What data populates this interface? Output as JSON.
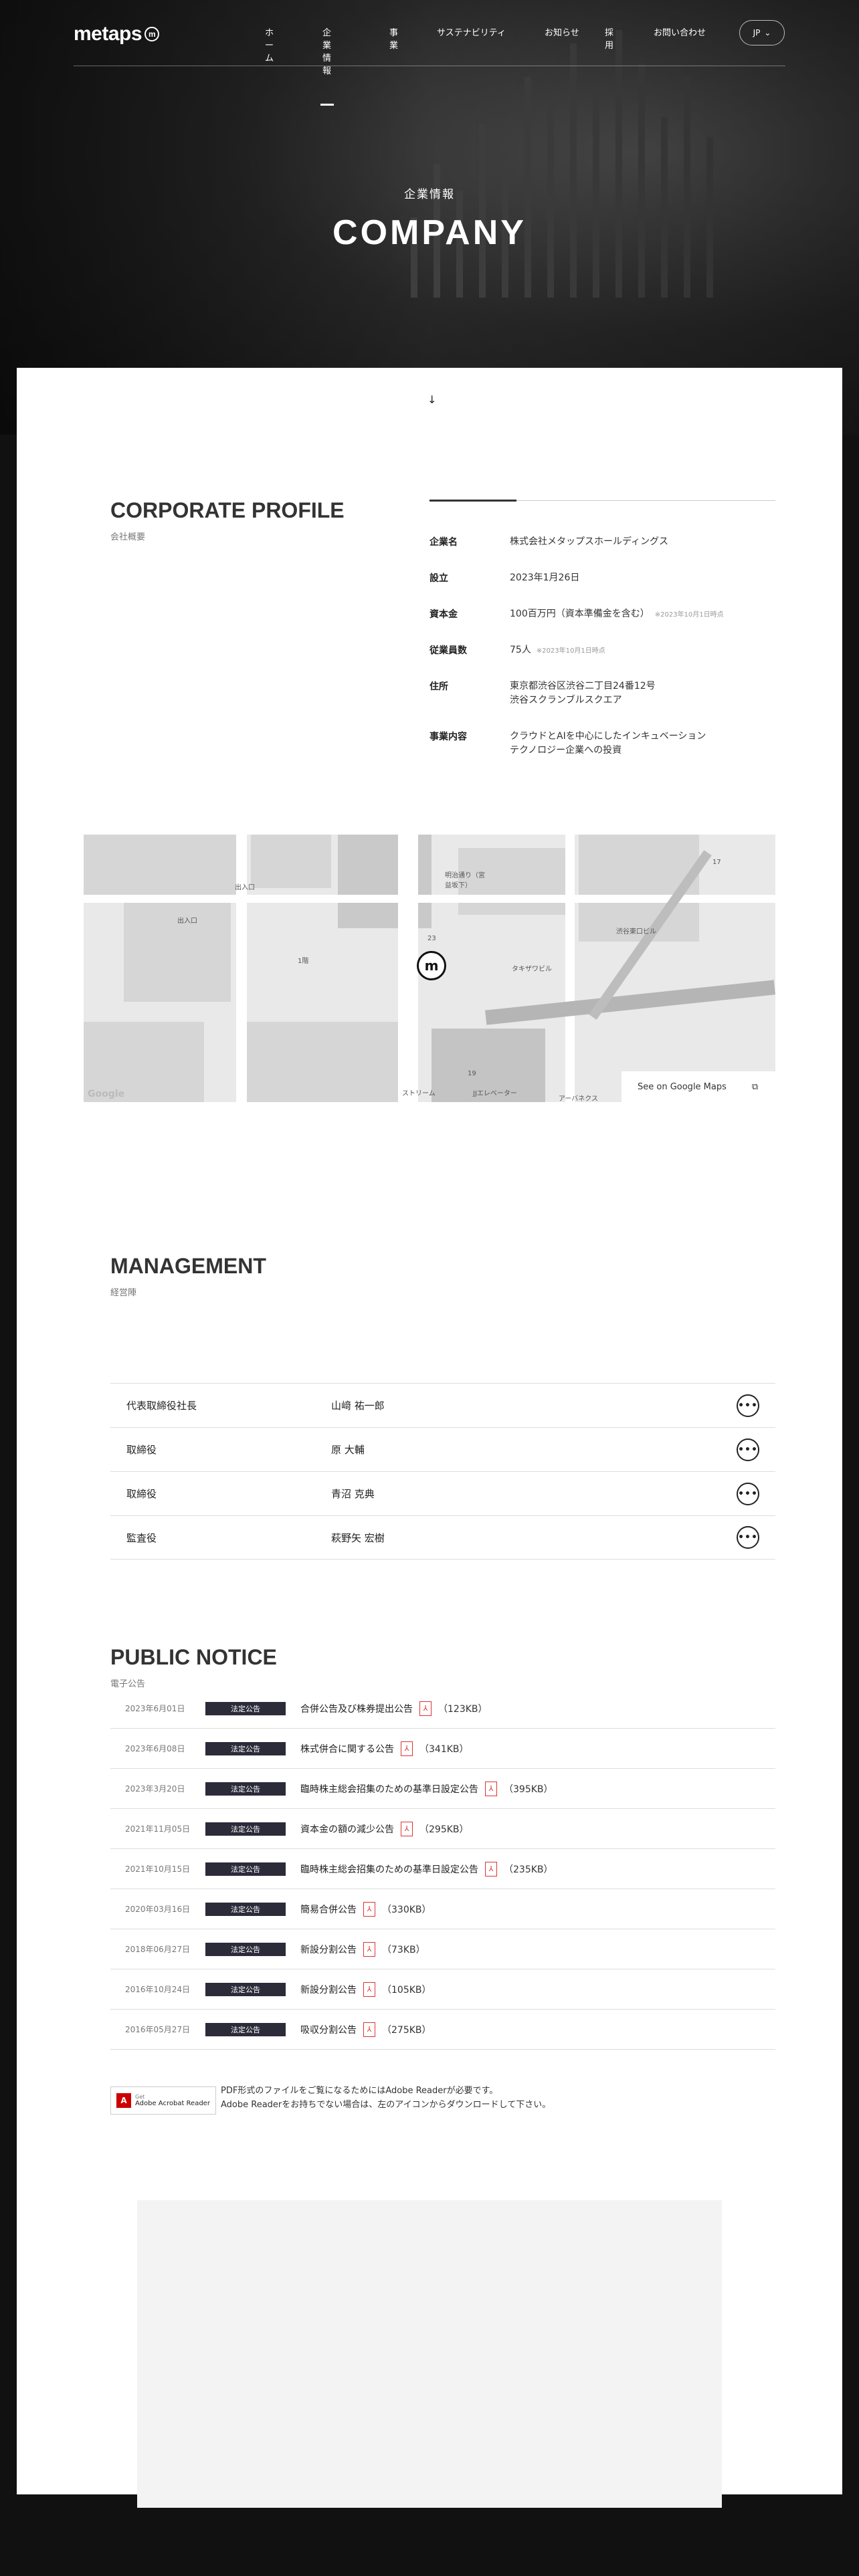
{
  "header": {
    "logo": "metaps",
    "logo_badge": "m",
    "nav": [
      "ホーム",
      "企業情報",
      "事業",
      "サステナビリティ",
      "お知らせ",
      "採用",
      "お問い合わせ"
    ],
    "active_nav": "企業情報",
    "lang": "JP"
  },
  "hero": {
    "subtitle": "企業情報",
    "title": "COMPANY"
  },
  "profile": {
    "title": "CORPORATE PROFILE",
    "subtitle": "会社概要",
    "rows": [
      {
        "label": "企業名",
        "value": "株式会社メタップスホールディングス",
        "note": ""
      },
      {
        "label": "設立",
        "value": "2023年1月26日",
        "note": ""
      },
      {
        "label": "資本金",
        "value": "100百万円（資本準備金を含む）",
        "note": "※2023年10月1日時点"
      },
      {
        "label": "従業員数",
        "value": "75人",
        "note": "※2023年10月1日時点"
      },
      {
        "label": "住所",
        "value": "東京都渋谷区渋谷二丁目24番12号",
        "value2": "渋谷スクランブルスクエア",
        "note": ""
      },
      {
        "label": "事業内容",
        "value": "クラウドとAIを中心にしたインキュベーション",
        "value2": "テクノロジー企業への投資",
        "note": ""
      }
    ]
  },
  "map": {
    "link": "See on Google Maps",
    "google": "Google",
    "labels": [
      "出入口",
      "出入口",
      "1階",
      "明治通り（宮益坂下）",
      "23",
      "19",
      "17",
      "渋谷東口ビル",
      "タキザワビル",
      "ストリーム",
      "JJエレベーター",
      "アーバネクス"
    ]
  },
  "management": {
    "title": "MANAGEMENT",
    "subtitle": "経営陣",
    "members": [
      {
        "role": "代表取締役社長",
        "name": "山﨑 祐一郎"
      },
      {
        "role": "取締役",
        "name": "原 大輔"
      },
      {
        "role": "取締役",
        "name": "青沼 克典"
      },
      {
        "role": "監査役",
        "name": "萩野矢 宏樹"
      }
    ]
  },
  "notice": {
    "title": "PUBLIC NOTICE",
    "subtitle": "電子公告",
    "badge": "法定公告",
    "items": [
      {
        "date": "2023年6月01日",
        "title": "合併公告及び株券提出公告",
        "size": "（123KB）"
      },
      {
        "date": "2023年6月08日",
        "title": "株式併合に関する公告",
        "size": "（341KB）"
      },
      {
        "date": "2023年3月20日",
        "title": "臨時株主総会招集のための基準日設定公告",
        "size": "（395KB）"
      },
      {
        "date": "2021年11月05日",
        "title": "資本金の額の減少公告",
        "size": "（295KB）"
      },
      {
        "date": "2021年10月15日",
        "title": "臨時株主総会招集のための基準日設定公告",
        "size": "（235KB）"
      },
      {
        "date": "2020年03月16日",
        "title": "簡易合併公告",
        "size": "（330KB）"
      },
      {
        "date": "2018年06月27日",
        "title": "新設分割公告",
        "size": "（73KB）"
      },
      {
        "date": "2016年10月24日",
        "title": "新設分割公告",
        "size": "（105KB）"
      },
      {
        "date": "2016年05月27日",
        "title": "吸収分割公告",
        "size": "（275KB）"
      }
    ],
    "acrobat_label": "Adobe Acrobat Reader",
    "acrobat_get": "Get",
    "acrobat_note_1": "PDF形式のファイルをご覧になるためにはAdobe Readerが必要です。",
    "acrobat_note_2": "Adobe Readerをお持ちでない場合は、左のアイコンからダウンロードして下さい。"
  }
}
